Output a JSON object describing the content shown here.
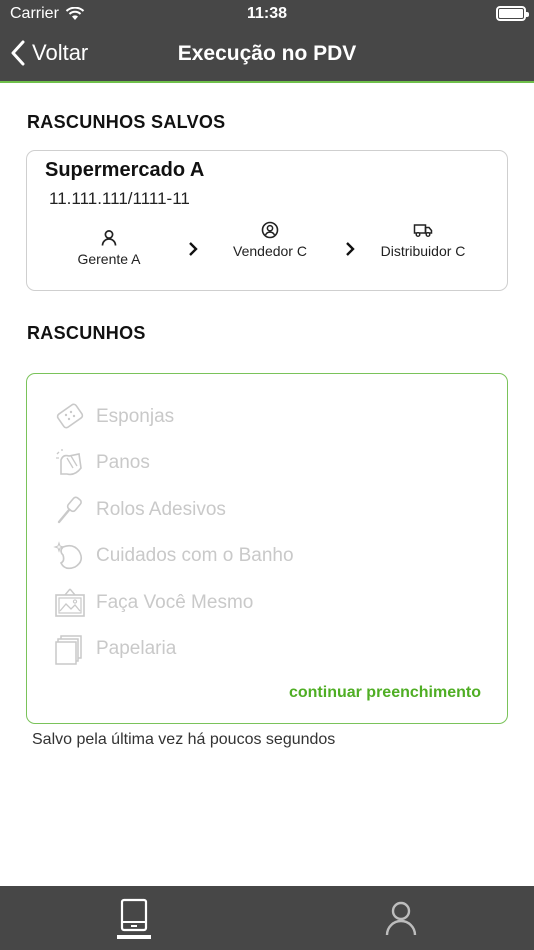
{
  "status": {
    "carrier": "Carrier",
    "time": "11:38"
  },
  "nav": {
    "back_label": "Voltar",
    "title": "Execução no PDV"
  },
  "saved_section": {
    "title": "RASCUNHOS SALVOS",
    "store_name": "Supermercado A",
    "cnpj": "11.111.111/1111-11",
    "steps": [
      {
        "icon": "person-icon",
        "label": "Gerente A"
      },
      {
        "icon": "user-circle-icon",
        "label": "Vendedor C"
      },
      {
        "icon": "truck-icon",
        "label": "Distribuidor C"
      }
    ]
  },
  "drafts_section": {
    "title": "RASCUNHOS",
    "categories": [
      {
        "icon": "sponge-icon",
        "label": "Esponjas"
      },
      {
        "icon": "cloth-icon",
        "label": "Panos"
      },
      {
        "icon": "lint-roller-icon",
        "label": "Rolos Adesivos"
      },
      {
        "icon": "bath-care-icon",
        "label": "Cuidados com o Banho"
      },
      {
        "icon": "diy-frame-icon",
        "label": "Faça Você Mesmo"
      },
      {
        "icon": "stationery-icon",
        "label": "Papelaria"
      }
    ],
    "continue_label": "continuar preenchimento",
    "saved_note": "Salvo pela última vez há poucos segundos"
  },
  "tabbar": {
    "tabs": [
      {
        "icon": "tablet-icon",
        "active": true
      },
      {
        "icon": "profile-icon",
        "active": false
      }
    ]
  },
  "colors": {
    "bar": "#474747",
    "accent": "#4fae24",
    "muted": "#c9c9c9"
  }
}
